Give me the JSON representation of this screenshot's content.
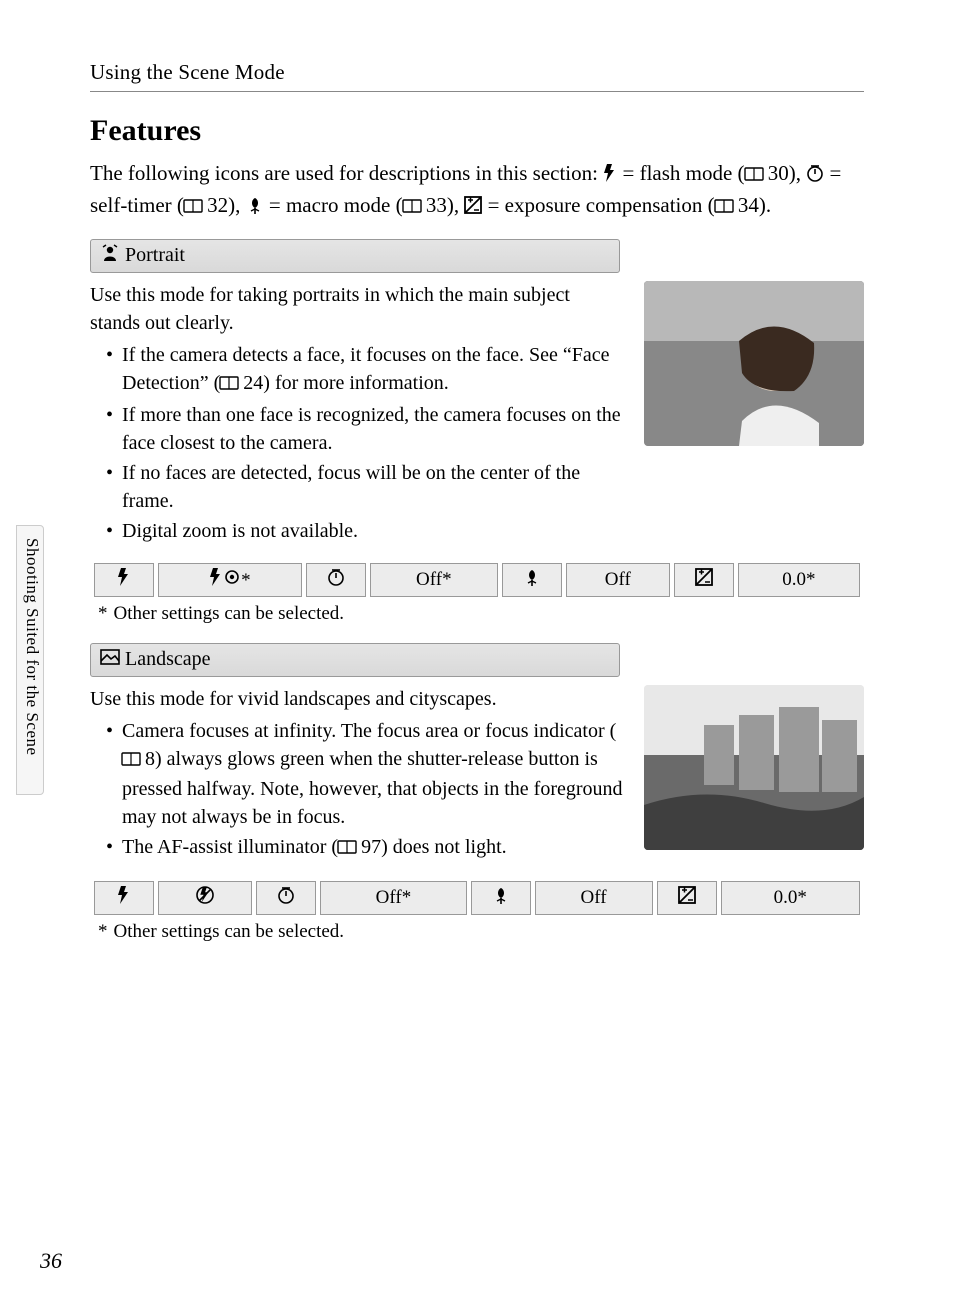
{
  "header": "Using the Scene Mode",
  "title": "Features",
  "intro": {
    "pre": "The following icons are used for descriptions in this section: ",
    "flash_eq": " = flash mode (",
    "ref1": " 30), ",
    "timer_eq": " = self-timer (",
    "ref2": " 32), ",
    "macro_eq": " = macro mode (",
    "ref3": " 33), ",
    "exp_eq": " = exposure compensation (",
    "ref4": " 34)."
  },
  "portrait": {
    "label": "Portrait",
    "lead": "Use this mode for taking portraits in which the main subject stands out clearly.",
    "bullets": [
      {
        "pre": "If the camera detects a face, it focuses on the face. See “Face Detection” (",
        "ref": " 24) for more information."
      },
      {
        "text": "If more than one face is recognized, the camera focuses on the face closest to the camera."
      },
      {
        "text": "If no faces are detected, focus will be on the center of the frame."
      },
      {
        "text": "Digital zoom is not available."
      }
    ],
    "row": {
      "flash": "*",
      "timer": "Off*",
      "macro": "Off",
      "exp": "0.0*"
    },
    "footnote": "Other settings can be selected."
  },
  "landscape": {
    "label": "Landscape",
    "lead": "Use this mode for vivid landscapes and cityscapes.",
    "bullets": [
      {
        "pre": "Camera focuses at infinity. The focus area or focus indicator (",
        "ref": " 8) always glows green when the shutter-release button is pressed halfway. Note, however, that objects in the foreground may not always be in focus."
      },
      {
        "pre2": "The AF-assist illuminator (",
        "ref2": " 97) does not light."
      }
    ],
    "row": {
      "flash": "",
      "timer": "Off*",
      "macro": "Off",
      "exp": "0.0*"
    },
    "footnote": "Other settings can be selected."
  },
  "sidetab": "Shooting Suited for the Scene",
  "pagenum": "36"
}
